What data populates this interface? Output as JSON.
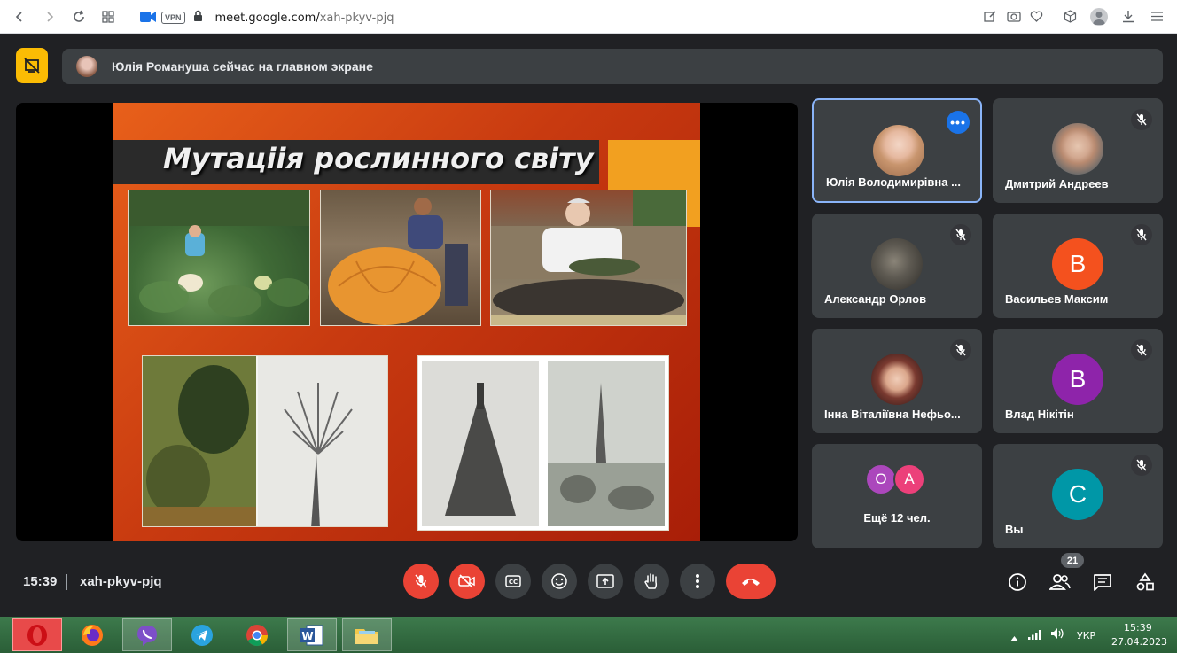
{
  "browser": {
    "url_host": "meet.google.com/",
    "url_path": "xah-pkyv-pjq",
    "vpn_label": "VPN"
  },
  "meet": {
    "notice": "Юлія Романуша сейчас на главном экране",
    "slide": {
      "title": "Мутаціія рослинного світу"
    },
    "participants": [
      {
        "name": "Юлія Володимирівна ...",
        "state": "speaking-menu"
      },
      {
        "name": "Дмитрий Андреев",
        "state": "muted"
      },
      {
        "name": "Александр Орлов",
        "state": "muted"
      },
      {
        "name": "Васильев Максим",
        "initial": "В",
        "color": "#f4511e",
        "state": "muted"
      },
      {
        "name": "Інна Віталіївна Нефьо...",
        "state": "muted"
      },
      {
        "name": "Влад Нікітін",
        "initial": "В",
        "color": "#8e24aa",
        "state": "muted"
      },
      {
        "name": "Ещё 12 чел.",
        "initials": [
          "О",
          "А"
        ],
        "colors": [
          "#ab47bc",
          "#ec407a"
        ]
      },
      {
        "name": "Вы",
        "initial": "С",
        "color": "#0097a7",
        "state": "muted"
      }
    ],
    "time": "15:39",
    "meeting_code": "xah-pkyv-pjq",
    "participant_count": "21",
    "colors": {
      "accent": "#8ab4f8",
      "danger": "#ea4335",
      "tile": "#3c4043",
      "background": "#202124"
    }
  },
  "taskbar": {
    "apps": [
      "opera-icon",
      "firefox-icon",
      "viber-icon",
      "telegram-icon",
      "chrome-icon",
      "word-icon",
      "explorer-icon"
    ],
    "lang": "УКР",
    "time": "15:39",
    "date": "27.04.2023"
  }
}
